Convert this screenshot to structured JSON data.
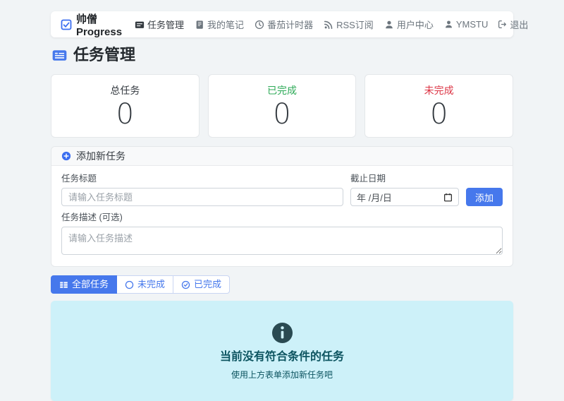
{
  "colors": {
    "primary": "#4678ec",
    "success": "#2daa57",
    "danger": "#dc3545",
    "info_bg": "#cdf1f9",
    "info_text": "#0c5460"
  },
  "navbar": {
    "brand": "帅僧Progress",
    "items": [
      {
        "label": "任务管理",
        "active": true
      },
      {
        "label": "我的笔记",
        "active": false
      },
      {
        "label": "番茄计时器",
        "active": false
      },
      {
        "label": "RSS订阅",
        "active": false
      },
      {
        "label": "用户中心",
        "active": false
      }
    ],
    "username": "YMSTU",
    "logout": "退出"
  },
  "page_title": "任务管理",
  "stats": [
    {
      "label": "总任务",
      "value": "0"
    },
    {
      "label": "已完成",
      "value": "0"
    },
    {
      "label": "未完成",
      "value": "0"
    }
  ],
  "add_form": {
    "header": "添加新任务",
    "title_label": "任务标题",
    "title_placeholder": "请输入任务标题",
    "date_label": "截止日期",
    "date_value": "年 /月/日",
    "submit": "添加",
    "desc_label": "任务描述 (可选)",
    "desc_placeholder": "请输入任务描述"
  },
  "filters": [
    {
      "label": "全部任务",
      "active": true
    },
    {
      "label": "未完成",
      "active": false
    },
    {
      "label": "已完成",
      "active": false
    }
  ],
  "empty_state": {
    "title": "当前没有符合条件的任务",
    "subtitle": "使用上方表单添加新任务吧"
  }
}
